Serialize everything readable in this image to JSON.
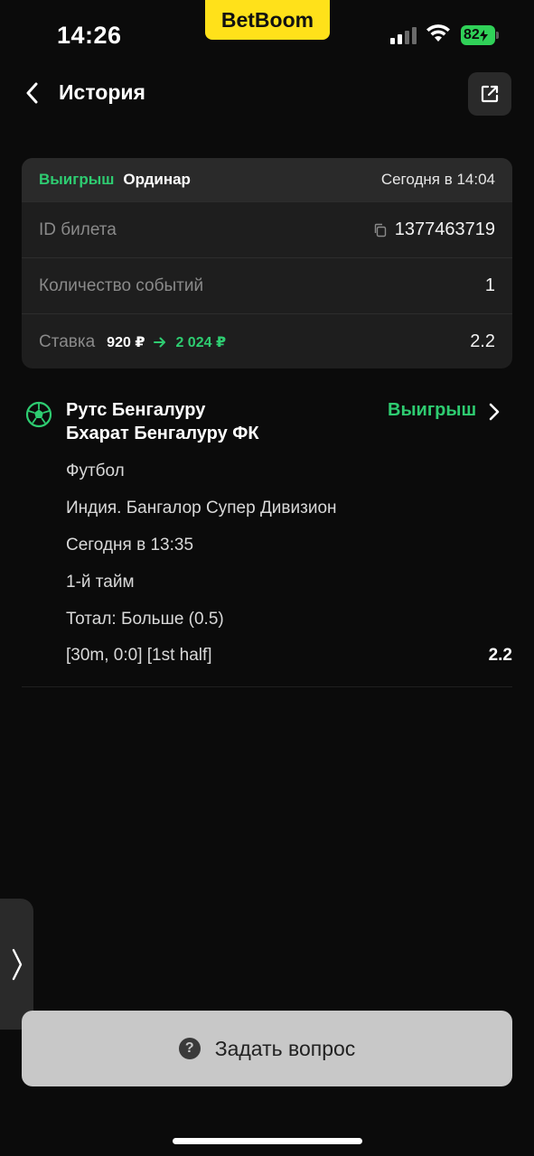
{
  "status_bar": {
    "time": "14:26",
    "brand": "BetBoom",
    "battery": "82"
  },
  "nav": {
    "title": "История"
  },
  "ticket": {
    "status": "Выигрыш",
    "type": "Ординар",
    "date": "Сегодня в 14:04",
    "id_label": "ID билета",
    "id_value": "1377463719",
    "events_label": "Количество событий",
    "events_value": "1",
    "stake_label": "Ставка",
    "stake_amount": "920 ₽",
    "stake_win": "2 024 ₽",
    "coef": "2.2"
  },
  "event": {
    "team1": "Рутс Бенгалуру",
    "team2": "Бхарат Бенгалуру ФК",
    "result": "Выигрыш",
    "sport": "Футбол",
    "league": "Индия. Бангалор Супер Дивизион",
    "time": "Сегодня в 13:35",
    "period": "1-й тайм",
    "market": "Тотал: Больше (0.5)",
    "details": "[30m, 0:0] [1st half]",
    "odd": "2.2"
  },
  "ask_button": {
    "label": "Задать вопрос"
  },
  "colors": {
    "win_green": "#2ecc71",
    "brand_yellow": "#ffe11a",
    "background": "#0b0b0b"
  }
}
